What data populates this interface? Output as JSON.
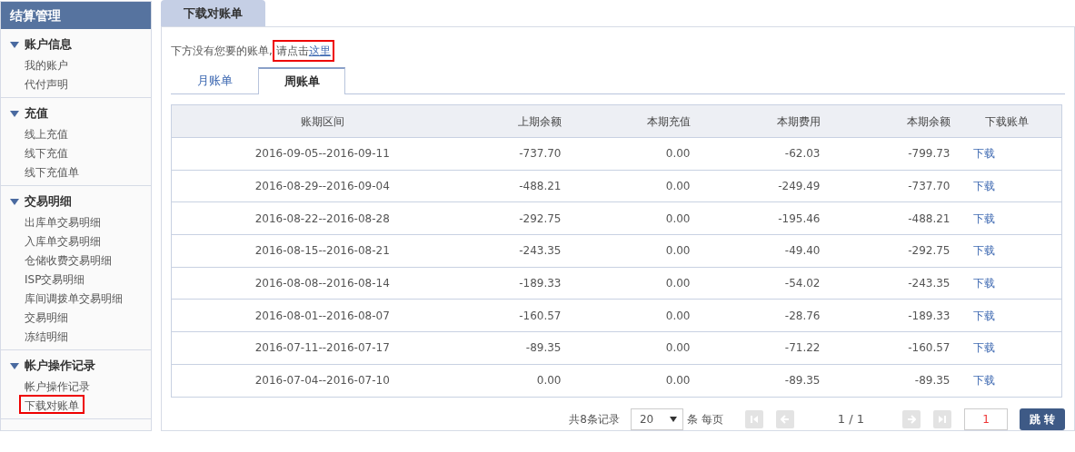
{
  "sidebar": {
    "title": "结算管理",
    "groups": [
      {
        "title": "账户信息",
        "expanded": true,
        "items": [
          {
            "label": "我的账户",
            "highlighted": false
          },
          {
            "label": "代付声明",
            "highlighted": false
          }
        ]
      },
      {
        "title": "充值",
        "expanded": true,
        "items": [
          {
            "label": "线上充值",
            "highlighted": false
          },
          {
            "label": "线下充值",
            "highlighted": false
          },
          {
            "label": "线下充值单",
            "highlighted": false
          }
        ]
      },
      {
        "title": "交易明细",
        "expanded": true,
        "items": [
          {
            "label": "出库单交易明细",
            "highlighted": false
          },
          {
            "label": "入库单交易明细",
            "highlighted": false
          },
          {
            "label": "仓储收费交易明细",
            "highlighted": false
          },
          {
            "label": "ISP交易明细",
            "highlighted": false
          },
          {
            "label": "库间调拨单交易明细",
            "highlighted": false
          },
          {
            "label": "交易明细",
            "highlighted": false
          },
          {
            "label": "冻结明细",
            "highlighted": false
          }
        ]
      },
      {
        "title": "帐户操作记录",
        "expanded": true,
        "items": [
          {
            "label": "帐户操作记录",
            "highlighted": false
          },
          {
            "label": "下载对账单",
            "highlighted": true
          }
        ]
      }
    ]
  },
  "page_tab": "下载对账单",
  "notice": {
    "text": "下方没有您要的账单,",
    "prompt": "请点击",
    "link": "这里",
    "highlighted": true
  },
  "tabs": [
    {
      "label": "月账单",
      "selected": false
    },
    {
      "label": "周账单",
      "selected": true
    }
  ],
  "table": {
    "columns": [
      "账期区间",
      "上期余额",
      "本期充值",
      "本期费用",
      "本期余额",
      "下载账单"
    ],
    "rows": [
      [
        "2016-09-05--2016-09-11",
        "-737.70",
        "0.00",
        "-62.03",
        "-799.73",
        "下载"
      ],
      [
        "2016-08-29--2016-09-04",
        "-488.21",
        "0.00",
        "-249.49",
        "-737.70",
        "下载"
      ],
      [
        "2016-08-22--2016-08-28",
        "-292.75",
        "0.00",
        "-195.46",
        "-488.21",
        "下载"
      ],
      [
        "2016-08-15--2016-08-21",
        "-243.35",
        "0.00",
        "-49.40",
        "-292.75",
        "下载"
      ],
      [
        "2016-08-08--2016-08-14",
        "-189.33",
        "0.00",
        "-54.02",
        "-243.35",
        "下载"
      ],
      [
        "2016-08-01--2016-08-07",
        "-160.57",
        "0.00",
        "-28.76",
        "-189.33",
        "下载"
      ],
      [
        "2016-07-11--2016-07-17",
        "-89.35",
        "0.00",
        "-71.22",
        "-160.57",
        "下载"
      ],
      [
        "2016-07-04--2016-07-10",
        "0.00",
        "0.00",
        "-89.35",
        "-89.35",
        "下载"
      ]
    ]
  },
  "pagination": {
    "total": "共8条记录",
    "page_size": "20",
    "per_page": "条 每页",
    "page": "1 / 1",
    "jump_value": "1",
    "jump_button": "跳 转"
  }
}
